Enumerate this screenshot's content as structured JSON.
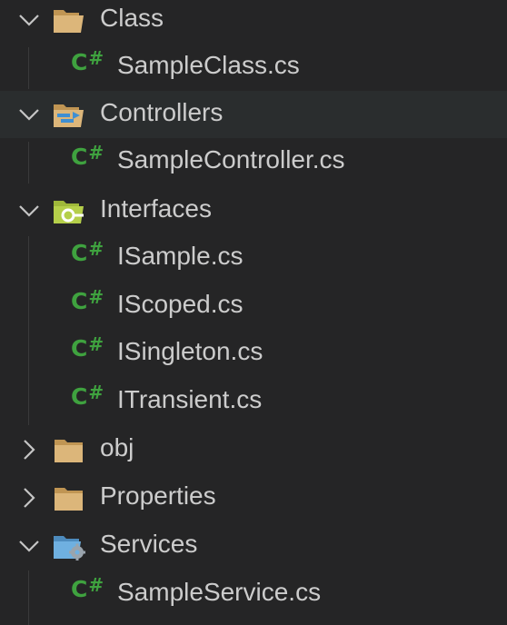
{
  "explorer": {
    "items": [
      {
        "label": "Class",
        "kind": "folder",
        "icon": "folder-icon",
        "expanded": true,
        "depth": 0
      },
      {
        "label": "SampleClass.cs",
        "kind": "file",
        "icon": "csharp-file-icon",
        "badge": "C#",
        "depth": 1
      },
      {
        "label": "Controllers",
        "kind": "folder",
        "icon": "controllers-folder-icon",
        "expanded": true,
        "depth": 0,
        "selected": true
      },
      {
        "label": "SampleController.cs",
        "kind": "file",
        "icon": "csharp-file-icon",
        "badge": "C#",
        "depth": 1
      },
      {
        "label": "Interfaces",
        "kind": "folder",
        "icon": "interfaces-folder-icon",
        "expanded": true,
        "depth": 0
      },
      {
        "label": "ISample.cs",
        "kind": "file",
        "icon": "csharp-file-icon",
        "badge": "C#",
        "depth": 1
      },
      {
        "label": "IScoped.cs",
        "kind": "file",
        "icon": "csharp-file-icon",
        "badge": "C#",
        "depth": 1
      },
      {
        "label": "ISingleton.cs",
        "kind": "file",
        "icon": "csharp-file-icon",
        "badge": "C#",
        "depth": 1
      },
      {
        "label": "ITransient.cs",
        "kind": "file",
        "icon": "csharp-file-icon",
        "badge": "C#",
        "depth": 1
      },
      {
        "label": "obj",
        "kind": "folder",
        "icon": "folder-icon",
        "expanded": false,
        "depth": 0
      },
      {
        "label": "Properties",
        "kind": "folder",
        "icon": "folder-icon",
        "expanded": false,
        "depth": 0
      },
      {
        "label": "Services",
        "kind": "folder",
        "icon": "services-folder-icon",
        "expanded": true,
        "depth": 0
      },
      {
        "label": "SampleService.cs",
        "kind": "file",
        "icon": "csharp-file-icon",
        "badge": "C#",
        "depth": 1
      }
    ]
  },
  "colors": {
    "background": "#252526",
    "selected_row": "#2a2d2e",
    "text": "#cccccc",
    "csharp_badge": "#3fa23f",
    "folder": "#c09553"
  }
}
